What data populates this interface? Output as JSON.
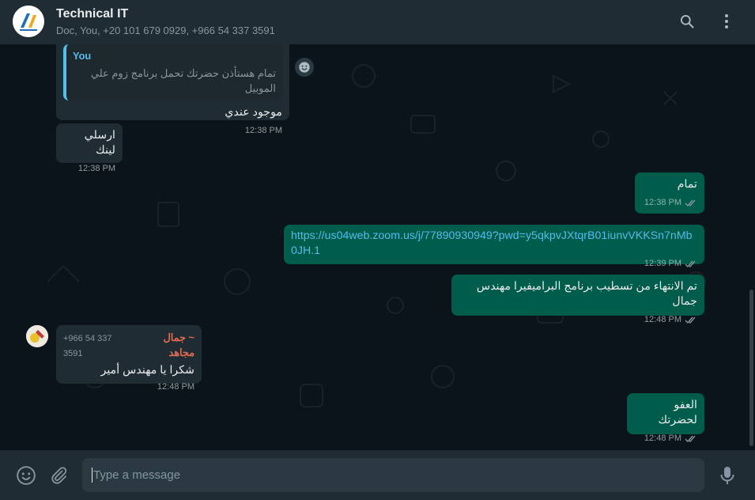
{
  "header": {
    "title": "Technical IT",
    "subtitle": "Doc, You, +20 101 679 0929, +966 54 337 3591",
    "icons": [
      "search-icon",
      "menu-icon"
    ]
  },
  "messages": [
    {
      "quote_author": "You",
      "quote_text": "تمام هستأذن حضرتك تحمل برنامج زوم علي الموبيل",
      "text": "موجود عندي",
      "time": "12:38 PM"
    },
    {
      "text": "ارسلي لينك",
      "time": "12:38 PM"
    },
    {
      "text": "تمام",
      "time": "12:38 PM"
    },
    {
      "text": "https://us04web.zoom.us/j/77890930949?pwd=y5qkpvJXtqrB01iunvVKKSn7nMb0JH.1",
      "time": "12:39 PM"
    },
    {
      "text": "تم الانتهاء من تسطيب برنامج البراميفيرا مهندس جمال",
      "time": "12:48 PM"
    },
    {
      "sender_number": "+966 54 337 3591",
      "sender_name": "~ جمال مجاهد",
      "text": "شكرا يا مهندس أمير",
      "time": "12:48 PM"
    },
    {
      "text": "العفو لحضرتك",
      "time": "12:48 PM"
    }
  ],
  "composer": {
    "placeholder": "Type a message",
    "icons": [
      "emoji-icon",
      "attach-icon",
      "microphone-icon"
    ]
  },
  "colors": {
    "header_bg": "#202c33",
    "chat_bg": "#0b141a",
    "incoming_bubble": "#202c33",
    "outgoing_bubble": "#005c4b",
    "link": "#53bdeb",
    "sender_name": "#e26a4f"
  }
}
